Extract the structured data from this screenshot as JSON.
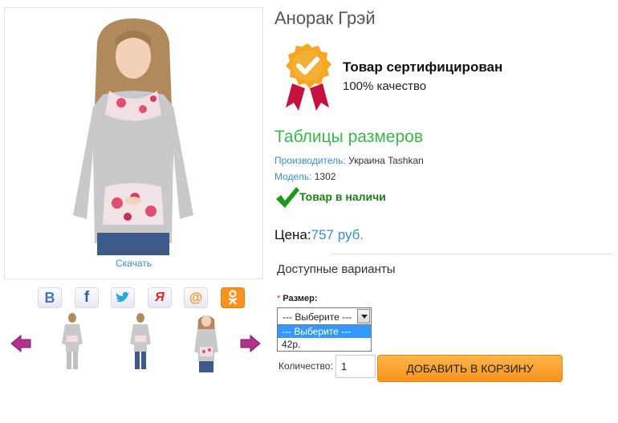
{
  "product": {
    "title": "Анорак Грэй",
    "download_label": "Скачать"
  },
  "certificate": {
    "title": "Товар сертифицирован",
    "subtitle": "100% качество"
  },
  "size_table_label": "Таблицы размеров",
  "specs": {
    "manufacturer_key": "Производитель:",
    "manufacturer_val": "Украина Tashkan",
    "model_key": "Модель:",
    "model_val": "1302"
  },
  "stock_label": "Товар в наличи",
  "price": {
    "label": "Цена:",
    "value": "757 руб."
  },
  "variants_title": "Доступные варианты",
  "size": {
    "required_mark": "*",
    "label": "Размер:",
    "selected": "--- Выберите ---",
    "options": [
      "--- Выберите ---",
      "42р."
    ]
  },
  "quantity": {
    "label": "Количество:",
    "value": "1"
  },
  "add_to_cart_label": "ДОБАВИТЬ В КОРЗИНУ",
  "social": [
    {
      "icon": "vk-icon",
      "glyph": "В"
    },
    {
      "icon": "facebook-icon",
      "glyph": "f"
    },
    {
      "icon": "twitter-icon",
      "glyph": ""
    },
    {
      "icon": "moimir-icon",
      "glyph": "Я"
    },
    {
      "icon": "mail-icon",
      "glyph": "@"
    },
    {
      "icon": "odnoklassniki-icon",
      "glyph": ""
    }
  ],
  "colors": {
    "link_blue": "#3c8dc9",
    "green": "#39b54a",
    "orange": "#f7931e",
    "arrow_purple": "#b0338d"
  }
}
